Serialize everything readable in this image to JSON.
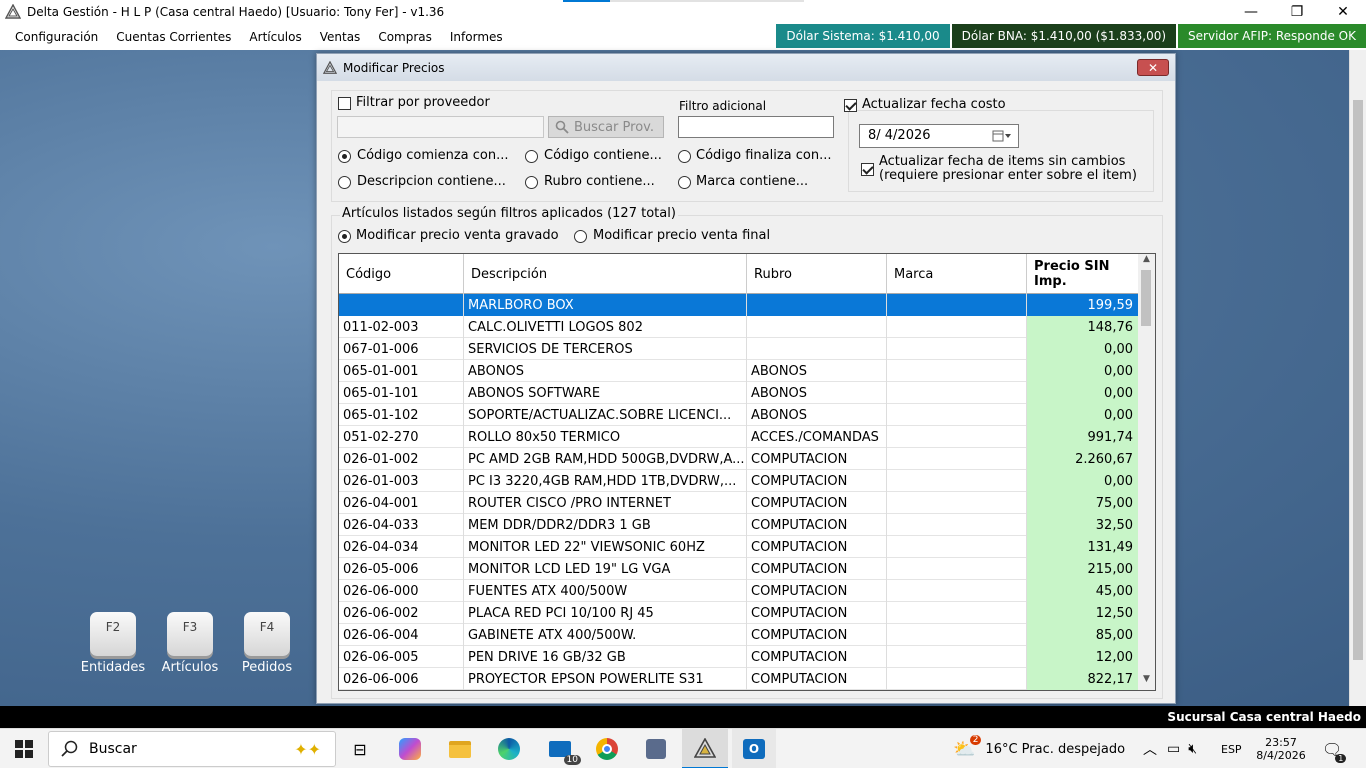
{
  "window": {
    "title": "Delta Gestión - H L P (Casa central Haedo) [Usuario: Tony Fer] - v1.36",
    "minimize": "—",
    "maximize": "❐",
    "close": "✕"
  },
  "menu": [
    "Configuración",
    "Cuentas Corrientes",
    "Artículos",
    "Ventas",
    "Compras",
    "Informes"
  ],
  "status": {
    "dolar_sistema": "Dólar Sistema: $1.410,00",
    "dolar_bna": "Dólar BNA: $1.410,00 ($1.833,00)",
    "afip": "Servidor AFIP:  Responde OK",
    "colors": {
      "teal": "#1a8a8a",
      "dark_green": "#1b3f1b",
      "green": "#2a8a2a"
    }
  },
  "shortcuts": [
    {
      "key": "F2",
      "label": "Entidades"
    },
    {
      "key": "F3",
      "label": "Artículos"
    },
    {
      "key": "F4",
      "label": "Pedidos"
    }
  ],
  "dialog": {
    "title": "Modificar Precios",
    "close": "✕",
    "filtrar_proveedor": "Filtrar por proveedor",
    "buscar_prov": "Buscar Prov.",
    "filtro_adicional": "Filtro adicional",
    "actualizar_fecha_costo": "Actualizar fecha costo",
    "fecha": "8/  4/2026",
    "actualizar_items_line1": "Actualizar fecha de items sin cambios",
    "actualizar_items_line2": "(requiere presionar enter sobre el item)",
    "radios": [
      "Código comienza con...",
      "Código contiene...",
      "Código finaliza con...",
      "Descripcion contiene...",
      "Rubro contiene...",
      "Marca contiene..."
    ],
    "listados": "Artículos listados según filtros aplicados (127 total)",
    "modo_gravado": "Modificar precio venta gravado",
    "modo_final": "Modificar precio venta final"
  },
  "table": {
    "headers": [
      "Código",
      "Descripción",
      "Rubro",
      "Marca",
      "Precio SIN",
      "Imp."
    ],
    "rows": [
      [
        "",
        "MARLBORO BOX",
        "",
        "",
        "199,59"
      ],
      [
        "011-02-003",
        "CALC.OLIVETTI LOGOS 802",
        "",
        "",
        "148,76"
      ],
      [
        "067-01-006",
        "SERVICIOS DE TERCEROS",
        "",
        "",
        "0,00"
      ],
      [
        "065-01-001",
        "ABONOS",
        "ABONOS",
        "",
        "0,00"
      ],
      [
        "065-01-101",
        "ABONOS SOFTWARE",
        "ABONOS",
        "",
        "0,00"
      ],
      [
        "065-01-102",
        "SOPORTE/ACTUALIZAC.SOBRE LICENCI...",
        "ABONOS",
        "",
        "0,00"
      ],
      [
        "051-02-270",
        "ROLLO 80x50 TERMICO",
        "ACCES./COMANDAS",
        "",
        "991,74"
      ],
      [
        "026-01-002",
        "PC AMD 2GB RAM,HDD 500GB,DVDRW,A...",
        "COMPUTACION",
        "",
        "2.260,67"
      ],
      [
        "026-01-003",
        "PC I3 3220,4GB RAM,HDD 1TB,DVDRW,...",
        "COMPUTACION",
        "",
        "0,00"
      ],
      [
        "026-04-001",
        "ROUTER CISCO /PRO INTERNET",
        "COMPUTACION",
        "",
        "75,00"
      ],
      [
        "026-04-033",
        "MEM DDR/DDR2/DDR3 1 GB",
        "COMPUTACION",
        "",
        "32,50"
      ],
      [
        "026-04-034",
        "MONITOR LED 22\" VIEWSONIC 60HZ",
        "COMPUTACION",
        "",
        "131,49"
      ],
      [
        "026-05-006",
        "MONITOR LCD LED 19\" LG VGA",
        "COMPUTACION",
        "",
        "215,00"
      ],
      [
        "026-06-000",
        "FUENTES ATX 400/500W",
        "COMPUTACION",
        "",
        "45,00"
      ],
      [
        "026-06-002",
        "PLACA RED PCI 10/100 RJ 45",
        "COMPUTACION",
        "",
        "12,50"
      ],
      [
        "026-06-004",
        "GABINETE ATX 400/500W.",
        "COMPUTACION",
        "",
        "85,00"
      ],
      [
        "026-06-005",
        "PEN DRIVE 16 GB/32 GB",
        "COMPUTACION",
        "",
        "12,00"
      ],
      [
        "026-06-006",
        "PROYECTOR EPSON POWERLITE S31",
        "COMPUTACION",
        "",
        "822,17"
      ]
    ]
  },
  "sucursal": "Sucursal Casa central Haedo",
  "taskbar": {
    "search_placeholder": "Buscar",
    "weather": "16°C  Prac. despejado",
    "lang": "ESP",
    "time": "23:57",
    "date": "8/4/2026",
    "mail_badge": "10",
    "weather_badge": "2",
    "notif_badge": "1"
  }
}
